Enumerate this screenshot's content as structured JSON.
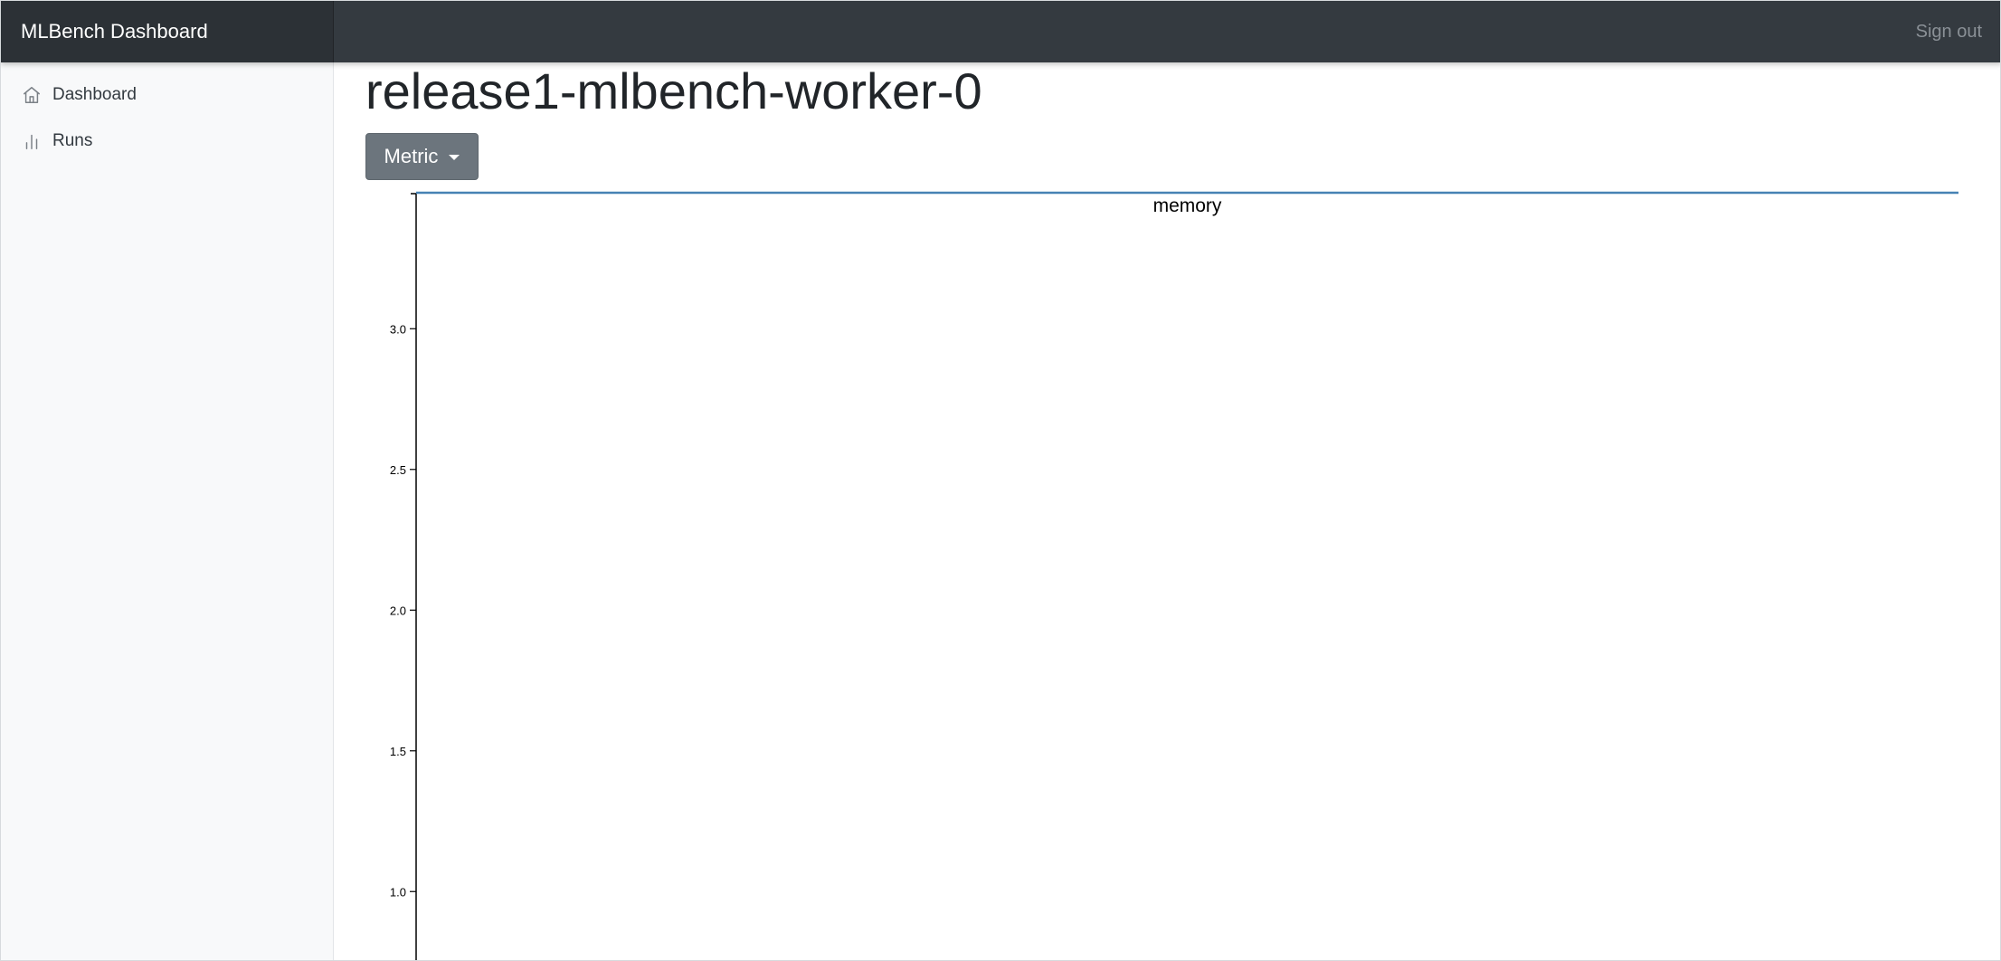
{
  "navbar": {
    "brand": "MLBench Dashboard",
    "signout_label": "Sign out",
    "background_color": "#343a40"
  },
  "sidebar": {
    "items": [
      {
        "label": "Dashboard",
        "icon": "home-icon"
      },
      {
        "label": "Runs",
        "icon": "bar-chart-icon"
      }
    ]
  },
  "main": {
    "title": "release1-mlbench-worker-0",
    "metric_button_label": "Metric"
  },
  "chart_data": {
    "type": "line",
    "title": "memory",
    "xlabel": "",
    "ylabel": "",
    "yticks": [
      "1.0",
      "1.5",
      "2.0",
      "2.5",
      "3.0"
    ],
    "ylim_visible": [
      0.75,
      3.48
    ],
    "series": [
      {
        "values": [
          3.48,
          3.48
        ],
        "color": "#4682b4"
      }
    ],
    "grid": false
  }
}
